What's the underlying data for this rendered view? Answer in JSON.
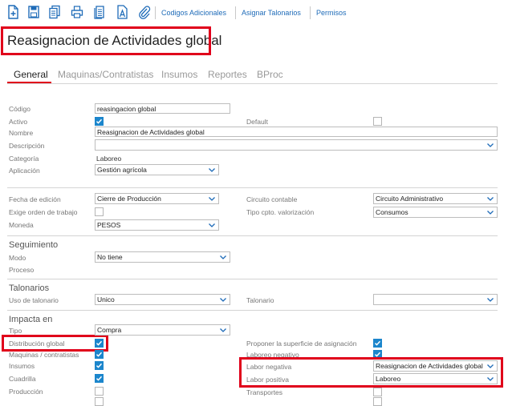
{
  "toolbar": {
    "icons": [
      "new-document-icon",
      "save-icon",
      "copy-icon",
      "print-icon",
      "report-icon",
      "text-icon",
      "attachment-icon"
    ],
    "links": [
      "Codigos Adicionales",
      "Asignar Talonarios",
      "Permisos"
    ]
  },
  "page": {
    "title": "Reasignacion de Actividades global"
  },
  "tabs": [
    "General",
    "Maquinas/Contratistas",
    "Insumos",
    "Reportes",
    "BProc"
  ],
  "general": {
    "codigo_label": "Código",
    "codigo_value": "reasingacion global",
    "activo_label": "Activo",
    "activo_checked": true,
    "default_label": "Default",
    "default_checked": false,
    "nombre_label": "Nombre",
    "nombre_value": "Reasignacion de Actividades global",
    "descripcion_label": "Descripción",
    "descripcion_value": "",
    "categoria_label": "Categoría",
    "categoria_value": "Laboreo",
    "aplicacion_label": "Aplicación",
    "aplicacion_value": "Gestión agrícola"
  },
  "edicion": {
    "fecha_label": "Fecha de edición",
    "fecha_value": "Cierre de Producción",
    "circuito_label": "Circuito contable",
    "circuito_value": "Circuito Administrativo",
    "exige_label": "Exige orden de trabajo",
    "exige_checked": false,
    "tipo_cpto_label": "Tipo cpto. valorización",
    "tipo_cpto_value": "Consumos",
    "moneda_label": "Moneda",
    "moneda_value": "PESOS"
  },
  "seguimiento": {
    "header": "Seguimiento",
    "modo_label": "Modo",
    "modo_value": "No tiene",
    "proceso_label": "Proceso"
  },
  "talonarios": {
    "header": "Talonarios",
    "uso_label": "Uso de talonario",
    "uso_value": "Unico",
    "talonario_label": "Talonario",
    "talonario_value": ""
  },
  "impacta": {
    "header": "Impacta en",
    "tipo_label": "Tipo",
    "tipo_value": "Compra",
    "distribucion_label": "Distribución global",
    "distribucion_checked": true,
    "maquinas_label": "Maquinas / contratistas",
    "maquinas_checked": true,
    "insumos_label": "Insumos",
    "insumos_checked": true,
    "cuadrilla_label": "Cuadrilla",
    "cuadrilla_checked": true,
    "produccion_label": "Producción",
    "produccion_checked": false,
    "proponer_label": "Proponer la superficie de asignación",
    "proponer_checked": true,
    "laboreo_negativo_label": "Laboreo negativo",
    "laboreo_negativo_checked": true,
    "labor_negativa_label": "Labor negativa",
    "labor_negativa_value": "Reasignacion de Actividades global",
    "labor_positiva_label": "Labor positiva",
    "labor_positiva_value": "Laboreo",
    "transportes_label": "Transportes",
    "transportes_checked": false
  },
  "colors": {
    "accent": "#1e6bb8",
    "checkbox": "#1c86cc",
    "highlight": "#e0001b"
  }
}
